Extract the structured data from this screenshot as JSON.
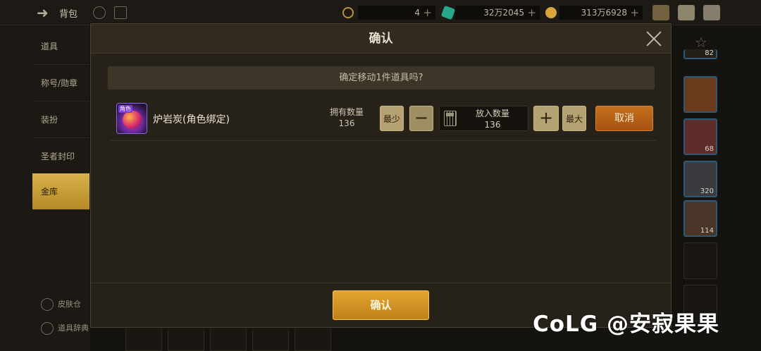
{
  "topbar": {
    "title": "背包",
    "resources": [
      {
        "value": "4"
      },
      {
        "value": "32万2045"
      },
      {
        "value": "313万6928"
      }
    ]
  },
  "sidebar": {
    "items": [
      {
        "label": "道具"
      },
      {
        "label": "称号/勋章"
      },
      {
        "label": "装扮"
      },
      {
        "label": "圣者封印"
      },
      {
        "label": "金库"
      }
    ],
    "bottom": [
      {
        "label": "皮肤仓"
      },
      {
        "label": "道具辞典"
      }
    ]
  },
  "grid": {
    "counts": [
      "82",
      "68",
      "320",
      "114"
    ]
  },
  "dialog": {
    "title": "确认",
    "question": "确定移动1件道具吗?",
    "item": {
      "icon_tag": "角色",
      "name": "炉岩炭(角色绑定)",
      "owned_label": "拥有数量",
      "owned_value": "136",
      "min_label": "最少",
      "minus_label": "−",
      "qty_label": "放入数量",
      "qty_value": "136",
      "plus_label": "+",
      "max_label": "最大",
      "cancel_label": "取消"
    },
    "confirm_label": "确认"
  },
  "watermark": "CoLG @安寂果果",
  "colors": {
    "accent_gold": "#d9a02a",
    "cancel_orange": "#b8621a",
    "panel_bg": "#272219"
  }
}
